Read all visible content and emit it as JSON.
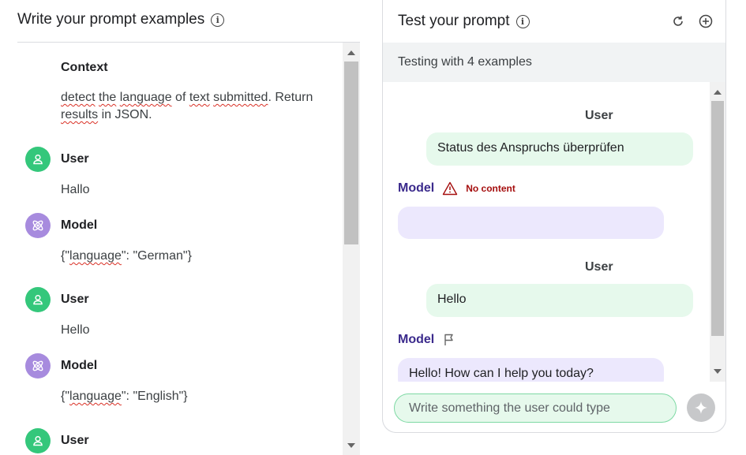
{
  "left": {
    "title": "Write your prompt examples",
    "context_label": "Context",
    "context_text_parts": [
      "detect",
      " ",
      "the",
      " ",
      "language",
      " of ",
      "text",
      " ",
      "submitted",
      ". Return ",
      "results",
      " in JSON."
    ],
    "items": [
      {
        "role": "User",
        "text": "Hallo"
      },
      {
        "role": "Model",
        "text_parts": [
          "{\"",
          "language",
          "\": \"German\"}"
        ]
      },
      {
        "role": "User",
        "text": "Hello"
      },
      {
        "role": "Model",
        "text_parts": [
          "{\"",
          "language",
          "\": \"English\"}"
        ]
      },
      {
        "role": "User",
        "text": ""
      }
    ]
  },
  "right": {
    "title": "Test your prompt",
    "testing_text": "Testing with 4 examples",
    "messages": [
      {
        "role": "User",
        "text": "Status des Anspruchs überprüfen"
      },
      {
        "role": "Model",
        "status": "No content",
        "text": ""
      },
      {
        "role": "User",
        "text": "Hello"
      },
      {
        "role": "Model",
        "text": "Hello! How can I help you today?"
      }
    ],
    "input_placeholder": "Write something the user could type"
  },
  "icons": {
    "info": "info-icon",
    "refresh": "refresh-icon",
    "add": "add-icon",
    "user_avatar": "person-icon",
    "model_avatar": "atom-icon",
    "warning": "warning-icon",
    "flag": "flag-icon",
    "send": "sparkle-icon"
  },
  "colors": {
    "user_avatar": "#34c77b",
    "model_avatar": "#a78bde",
    "user_bubble": "#e6f9ec",
    "model_bubble": "#ece8fd",
    "model_label": "#3b2a8c",
    "warning": "#a50e0e"
  }
}
